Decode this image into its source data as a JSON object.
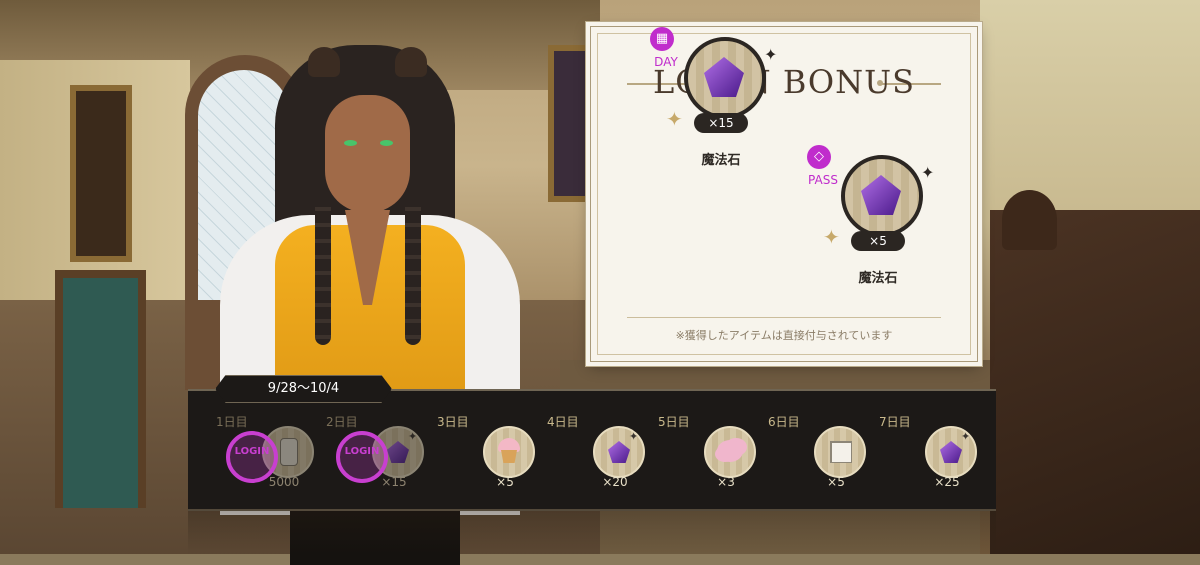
{
  "panel": {
    "title": "LOGIN BONUS",
    "note": "※獲得したアイテムは直接付与されています",
    "rewards": [
      {
        "tag": "DAY",
        "tag_icon": "calendar-icon",
        "icon": "magic-stone-icon",
        "quantity": "×15",
        "name": "魔法石"
      },
      {
        "tag": "PASS",
        "tag_icon": "diamond-icon",
        "icon": "magic-stone-icon",
        "quantity": "×5",
        "name": "魔法石"
      }
    ]
  },
  "strip": {
    "date_range": "9/28〜10/4",
    "days": [
      {
        "label": "1日目",
        "icon": "mad-money-icon",
        "quantity": "5000",
        "claimed": true
      },
      {
        "label": "2日目",
        "icon": "magic-stone-icon",
        "quantity": "×15",
        "claimed": true
      },
      {
        "label": "3日目",
        "icon": "cupcake-icon",
        "quantity": "×5",
        "claimed": false
      },
      {
        "label": "4日目",
        "icon": "magic-stone-icon",
        "quantity": "×20",
        "claimed": false
      },
      {
        "label": "5日目",
        "icon": "cotton-candy-icon",
        "quantity": "×3",
        "claimed": false
      },
      {
        "label": "6日目",
        "icon": "sugar-cube-icon",
        "quantity": "×5",
        "claimed": false
      },
      {
        "label": "7日目",
        "icon": "magic-stone-icon",
        "quantity": "×25",
        "claimed": false
      }
    ],
    "stamp_text": "LOGIN"
  },
  "colors": {
    "accent_magenta": "#c02ccc",
    "strip_bg": "#1c1917",
    "panel_bg": "#f7f4ec"
  }
}
